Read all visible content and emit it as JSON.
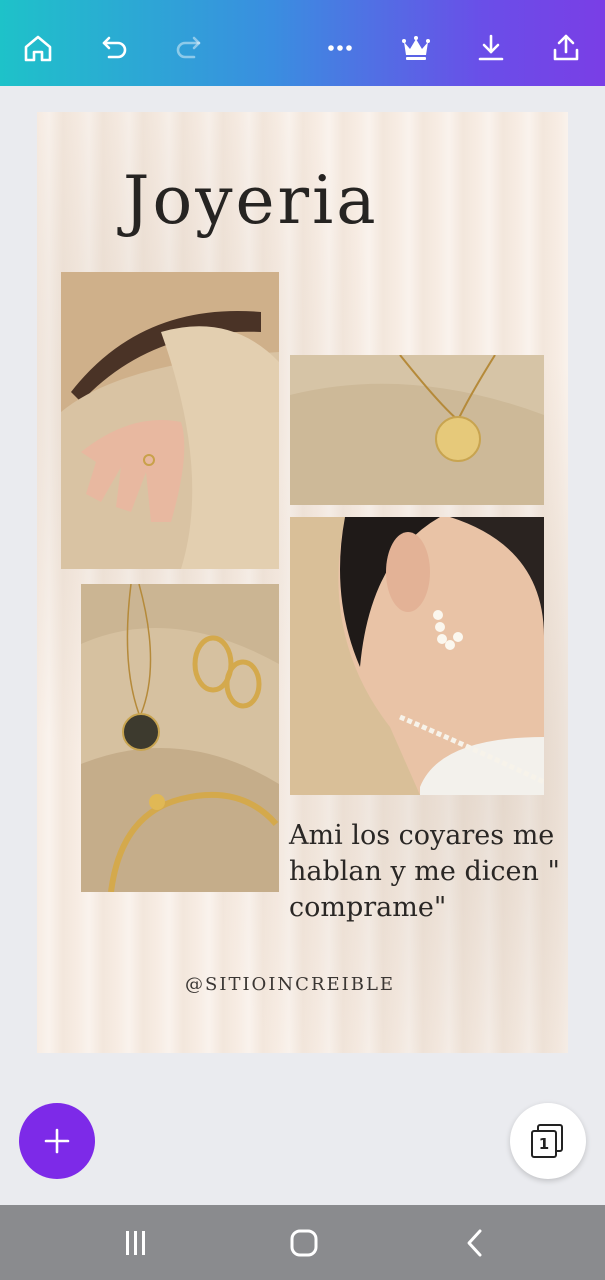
{
  "toolbar": {
    "icons": [
      "home-icon",
      "undo-icon",
      "redo-icon",
      "more-icon",
      "crown-icon",
      "download-icon",
      "share-icon"
    ],
    "colors": {
      "gradient_start": "#1ec2c9",
      "gradient_end": "#7a3ee6"
    }
  },
  "design": {
    "title": "Joyeria",
    "quote": "Ami los coyares me hablan y me dicen \" comprame\"",
    "handle": "@SITIOINCREIBLE",
    "photos": [
      {
        "name": "hand-with-ring-photo"
      },
      {
        "name": "pendant-necklace-photo"
      },
      {
        "name": "jewelry-set-photo"
      },
      {
        "name": "pearl-earrings-photo"
      }
    ]
  },
  "fab": {
    "add_icon": "plus-icon",
    "add_color": "#7d2ae8",
    "pages_count": "1"
  },
  "system_nav": {
    "icons": [
      "recent-apps-icon",
      "home-circle-icon",
      "back-icon"
    ]
  }
}
